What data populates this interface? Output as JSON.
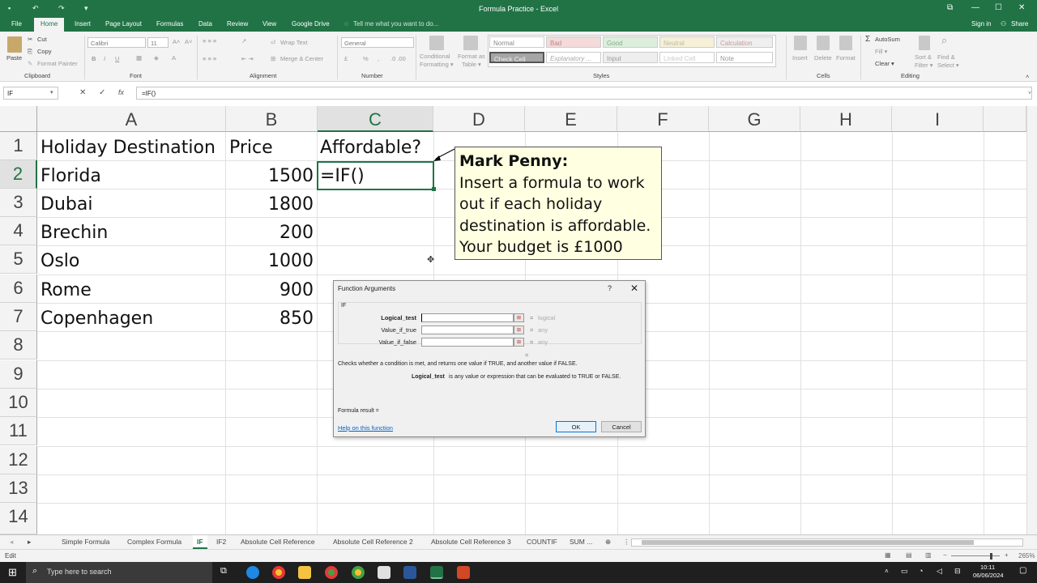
{
  "window": {
    "title": "Formula Practice - Excel",
    "quick_access": [
      "↶",
      "↷",
      "▾"
    ],
    "controls": [
      "⧉",
      "—",
      "☐",
      "✕"
    ]
  },
  "ribbon_tabs": [
    "File",
    "Home",
    "Insert",
    "Page Layout",
    "Formulas",
    "Data",
    "Review",
    "View",
    "Google Drive"
  ],
  "tell_me": "Tell me what you want to do...",
  "account": {
    "signin": "Sign in",
    "share": "Share"
  },
  "ribbon": {
    "paste": "Paste",
    "cut": "Cut",
    "copy": "Copy",
    "format_painter": "Format Painter",
    "font_name": "Calibri",
    "font_size": "11",
    "bold": "B",
    "italic": "I",
    "underline": "U",
    "wrap_text": "Wrap Text",
    "merge_center": "Merge & Center",
    "number_format": "General",
    "currency": "£",
    "percent": "%",
    "comma": ",",
    "cond_format": [
      "Conditional",
      "Formatting ▾"
    ],
    "format_table": [
      "Format as",
      "Table ▾"
    ],
    "styles": [
      "Normal",
      "Bad",
      "Good",
      "Neutral",
      "Calculation",
      "Check Cell",
      "Explanatory ...",
      "Input",
      "Linked Cell",
      "Note"
    ],
    "insert": "Insert",
    "delete": "Delete",
    "format": "Format",
    "autosum": "AutoSum",
    "fill": "Fill ▾",
    "clear": "Clear ▾",
    "sort": [
      "Sort &",
      "Filter ▾"
    ],
    "find": [
      "Find &",
      "Select ▾"
    ],
    "groups": [
      "Clipboard",
      "Font",
      "Alignment",
      "Number",
      "Styles",
      "Cells",
      "Editing"
    ]
  },
  "formula_bar": {
    "name_box": "IF",
    "cancel": "✕",
    "enter": "✓",
    "fx": "fx",
    "content": "=IF()"
  },
  "columns": [
    "A",
    "B",
    "C",
    "D",
    "E",
    "F",
    "G",
    "H",
    "I"
  ],
  "rows": [
    "1",
    "2",
    "3",
    "4",
    "5",
    "6",
    "7",
    "8",
    "9",
    "10",
    "11",
    "12",
    "13",
    "14"
  ],
  "cells": {
    "header": [
      "Holiday Destination",
      "Price",
      "Affordable?"
    ],
    "destinations": [
      "Florida",
      "Dubai",
      "Brechin",
      "Oslo",
      "Rome",
      "Copenhagen"
    ],
    "prices": [
      "1500",
      "1800",
      "200",
      "1000",
      "900",
      "850"
    ],
    "active_cell_text": "=IF()"
  },
  "comment": {
    "author": "Mark Penny:",
    "lines": [
      "Insert a formula to work",
      "out if each holiday",
      "destination is affordable.",
      "Your budget is £1000"
    ]
  },
  "dialog": {
    "title": "Function Arguments",
    "help": "?",
    "close": "✕",
    "function": "IF",
    "args": [
      {
        "label": "Logical_test",
        "value": "logical"
      },
      {
        "label": "Value_if_true",
        "value": "any"
      },
      {
        "label": "Value_if_false",
        "value": "any"
      }
    ],
    "eq": "=",
    "description": "Checks whether a condition is met, and returns one value if TRUE, and another value if FALSE.",
    "arg_name": "Logical_test",
    "arg_desc": "is any value or expression that can be evaluated to TRUE or FALSE.",
    "formula_result": "Formula result =",
    "help_link": "Help on this function",
    "ok": "OK",
    "cancel": "Cancel"
  },
  "sheet_tabs": [
    "Simple Formula",
    "Complex Formula",
    "IF",
    "IF2",
    "Absolute Cell Reference",
    "Absolute Cell Reference 2",
    "Absolute Cell Reference 3",
    "COUNTIF",
    "SUM ..."
  ],
  "active_sheet": "IF",
  "status": {
    "mode": "Edit",
    "zoom": "265%"
  },
  "taskbar": {
    "search": "Type here to search",
    "time": "10:11",
    "date": "06/06/2024"
  },
  "colors": {
    "excel_green": "#217346",
    "comment_bg": "#ffffe1"
  }
}
